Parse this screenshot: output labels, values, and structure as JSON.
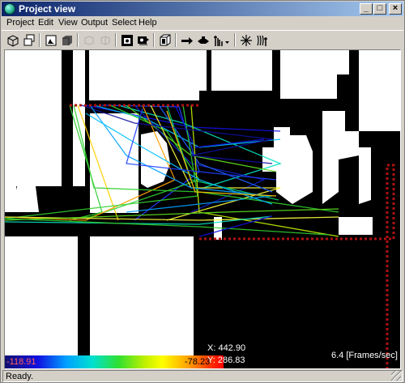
{
  "window": {
    "title": "Project view",
    "controls": {
      "minimize": "_",
      "maximize": "□",
      "close": "×"
    }
  },
  "menu": [
    {
      "label": "Project"
    },
    {
      "label": "Edit"
    },
    {
      "label": "View"
    },
    {
      "label": "Output"
    },
    {
      "label": "Select"
    },
    {
      "label": "Help"
    }
  ],
  "toolbar": {
    "icons": [
      "open-cube-icon",
      "cubes-icon",
      "picture-frame-icon",
      "solid-box-icon",
      "copy-disabled-icon",
      "paste-disabled-icon",
      "camera-icon",
      "camera-rotate-icon",
      "building-icon",
      "ray-arrow-icon",
      "receiver-eye-icon",
      "antenna-dropdown-icon",
      "spark-icon",
      "waves-icon"
    ]
  },
  "view": {
    "colorbar": {
      "min": "-118.91",
      "max": "-78.23"
    },
    "cursor": {
      "x": "X: 442.90",
      "y": "Y: 286.83"
    },
    "fps": "6.4 [Frames/sec]",
    "colors": {
      "background": "#000000",
      "buildings": "#ffffff",
      "route": "#c00000"
    }
  },
  "status": {
    "text": "Ready."
  }
}
